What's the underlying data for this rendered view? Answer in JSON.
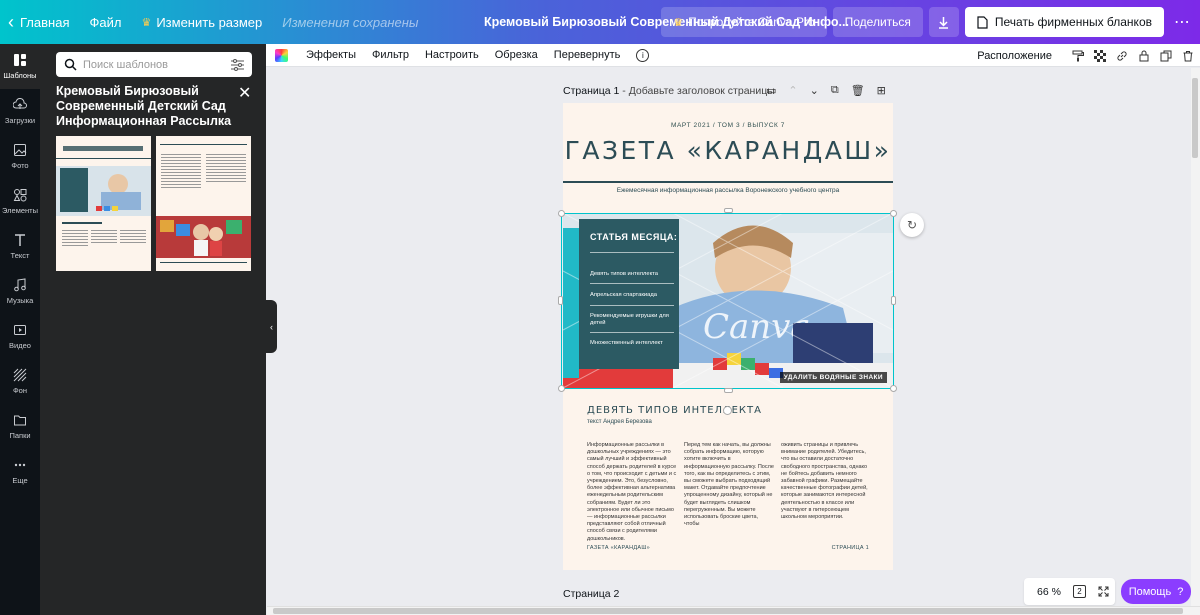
{
  "colors": {
    "accent": "#00c4cc",
    "brand_purple": "#7d2ae8",
    "newsletter_teal": "#2c4c55",
    "page_bg": "#fdf4ec"
  },
  "topbar": {
    "home": "Главная",
    "file": "Файл",
    "resize": "Изменить размер",
    "saved_status": "Изменения сохранены",
    "doc_title": "Кремовый Бирюзовый Современный Детский Сад Инфо...",
    "try_pro": "Попробуйте Canva Pro",
    "share": "Поделиться",
    "print": "Печать фирменных бланков"
  },
  "rail": {
    "items": [
      {
        "label": "Шаблоны",
        "icon": "templates-icon"
      },
      {
        "label": "Загрузки",
        "icon": "upload-icon"
      },
      {
        "label": "Фото",
        "icon": "photo-icon"
      },
      {
        "label": "Элементы",
        "icon": "elements-icon"
      },
      {
        "label": "Текст",
        "icon": "text-icon"
      },
      {
        "label": "Музыка",
        "icon": "music-icon"
      },
      {
        "label": "Видео",
        "icon": "video-icon"
      },
      {
        "label": "Фон",
        "icon": "background-icon"
      },
      {
        "label": "Папки",
        "icon": "folder-icon"
      },
      {
        "label": "Еще",
        "icon": "more-icon"
      }
    ]
  },
  "panel": {
    "search_placeholder": "Поиск шаблонов",
    "title": "Кремовый Бирюзовый Современный Детский Сад Информационная Рассылка"
  },
  "edit_toolbar": {
    "effects": "Эффекты",
    "filter": "Фильтр",
    "adjust": "Настроить",
    "crop": "Обрезка",
    "flip": "Перевернуть",
    "position": "Расположение"
  },
  "canvas": {
    "page1_label": "Страница 1",
    "page1_hint": " - Добавьте заголовок страницы",
    "page2_label": "Страница 2",
    "zoom": "66 %",
    "page_count": "2",
    "help": "Помощь",
    "help_mark": "?"
  },
  "newsletter": {
    "issue_line": "МАРТ 2021 / ТОМ 3 / ВЫПУСК 7",
    "masthead": "ГАЗЕТА «КАРАНДАШ»",
    "subtitle": "Ежемесячная информационная рассылка Воронежского учебного центра",
    "watermark_button": "УДАЛИТЬ ВОДЯНЫЕ ЗНАКИ",
    "article_box": {
      "title": "СТАТЬЯ МЕСЯЦА:",
      "items": [
        "Девять типов интеллекта",
        "Апрельская спартакиада",
        "Рекомендуемые игрушки для детей",
        "Множественный интеллект"
      ]
    },
    "headline": "ДЕВЯТЬ ТИПОВ ИНТЕЛЛЕКТА",
    "byline": "текст Андрея Березова",
    "columns": [
      "Информационные рассылки в дошкольных учреждениях — это самый лучший и эффективный способ держать родителей в курсе о том, что происходит с детьми и с учреждением. Это, безусловно, более эффективная альтернатива еженедельным родительским собраниям. Будет ли это электронное или обычное письмо — информационные рассылки представляют собой отличный способ связи с родителями дошкольников.",
      "Перед тем как начать, вы должны собрать информацию, которую хотите включить в информационную рассылку. После того, как вы определитесь с этим, вы сможете выбрать подходящий макет. Отдавайте предпочтение упрощенному дизайну, который не будет выглядеть слишком перегруженным. Вы можете использовать броские цвета, чтобы",
      "оживить страницы и привлечь внимание родителей. Убедитесь, что вы оставили достаточно свободного пространства, однако не бойтесь добавить немного забавной графики. Размещайте качественные фотографии детей, которые занимаются интересной деятельностью в классе или участвуют в питерсеющем школьном мероприятии."
    ],
    "footer_left": "ГАЗЕТА «КАРАНДАШ»",
    "footer_right": "СТРАНИЦА 1"
  }
}
